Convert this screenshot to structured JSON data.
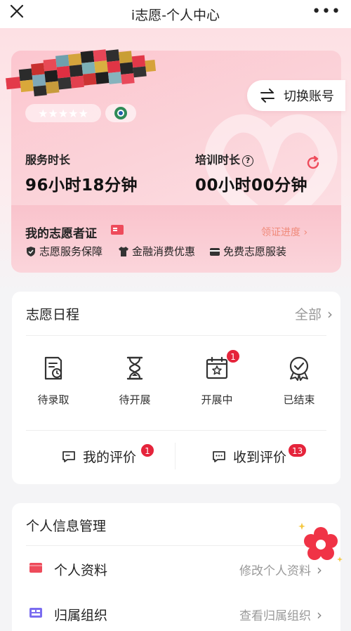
{
  "nav": {
    "title": "i志愿-个人中心",
    "more": "•••"
  },
  "profile": {
    "rating_stars": "★★★★★",
    "switch_account_label": "切换账号"
  },
  "stats": {
    "service_label": "服务时长",
    "service_value": "96小时18分钟",
    "training_label": "培训时长",
    "training_help": "?",
    "training_value": "00小时00分钟"
  },
  "certificate": {
    "title": "我的志愿者证",
    "progress_link": "领证进度 ›",
    "benefits": [
      "志愿服务保障",
      "金融消费优惠",
      "免费志愿服装"
    ]
  },
  "schedule": {
    "title": "志愿日程",
    "all_link": "全部",
    "items": [
      {
        "label": "待录取",
        "icon": "document-clock-icon"
      },
      {
        "label": "待开展",
        "icon": "hourglass-icon"
      },
      {
        "label": "开展中",
        "icon": "calendar-star-icon",
        "badge": "1"
      },
      {
        "label": "已结束",
        "icon": "award-check-icon"
      }
    ],
    "my_review": {
      "label": "我的评价",
      "badge": "1"
    },
    "received_review": {
      "label": "收到评价",
      "badge": "13"
    }
  },
  "personal": {
    "title": "个人信息管理",
    "rows": [
      {
        "label": "个人资料",
        "action": "修改个人资料",
        "icon_color": "#ee4b5b"
      },
      {
        "label": "归属组织",
        "action": "查看归属组织",
        "icon_color": "#7a6cf0"
      }
    ]
  },
  "colors": {
    "accent": "#ee4b5b",
    "badge": "#e5243b",
    "link_orange": "#f08a7a",
    "org_purple": "#7a6cf0"
  }
}
